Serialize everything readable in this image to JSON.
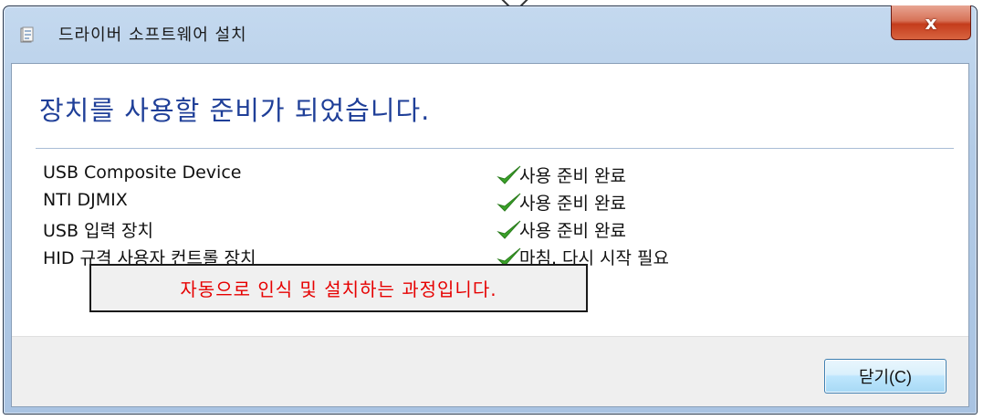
{
  "window": {
    "title": "드라이버 소프트웨어 설치",
    "close_symbol": "x"
  },
  "main": {
    "heading": "장치를 사용할 준비가 되었습니다.",
    "devices": [
      {
        "name": "USB Composite Device",
        "status": "사용 준비 완료",
        "status_icon": "check-icon"
      },
      {
        "name": "NTI DJMIX",
        "status": "사용 준비 완료",
        "status_icon": "check-icon"
      },
      {
        "name": "USB 입력 장치",
        "status": "사용 준비 완료",
        "status_icon": "check-icon"
      },
      {
        "name": "HID 규격 사용자 컨트롤 장치",
        "status": "마침. 다시 시작 필요",
        "status_icon": "check-icon"
      }
    ]
  },
  "annotation": {
    "text": "자동으로 인식 및 설치하는 과정입니다."
  },
  "footer": {
    "close_label": "닫기(C)"
  },
  "colors": {
    "heading": "#1f3f98",
    "annotation_text": "#e60000",
    "check": "#3aa229"
  }
}
